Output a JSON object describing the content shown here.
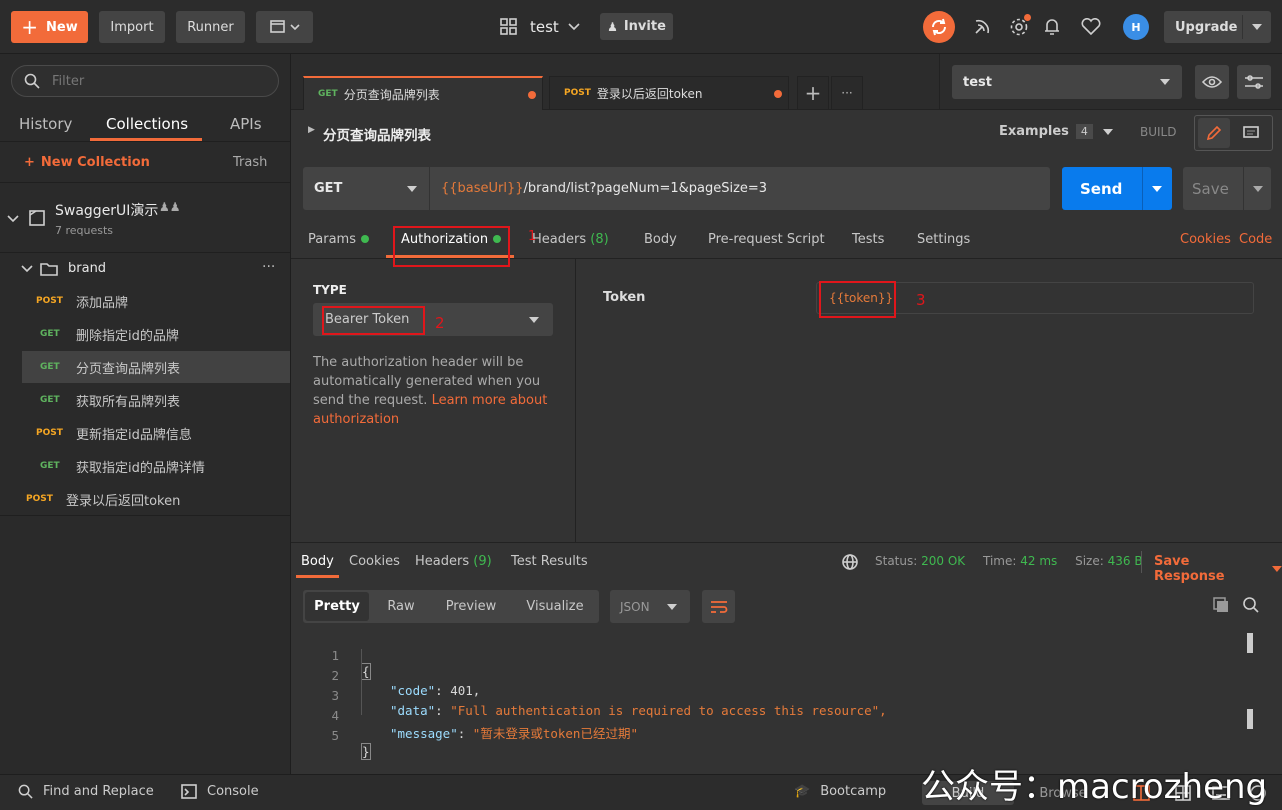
{
  "topbar": {
    "new_label": "New",
    "import_label": "Import",
    "runner_label": "Runner",
    "workspace_name": "test",
    "invite_label": "Invite",
    "upgrade_label": "Upgrade"
  },
  "sidebar": {
    "filter_placeholder": "Filter",
    "tabs": [
      "History",
      "Collections",
      "APIs"
    ],
    "active_tab": "Collections",
    "new_collection_label": "New Collection",
    "trash_label": "Trash",
    "collection": {
      "name": "SwaggerUI演示",
      "count": "7 requests"
    },
    "folder": {
      "name": "brand"
    },
    "items": [
      {
        "method": "POST",
        "label": "添加品牌"
      },
      {
        "method": "GET",
        "label": "删除指定id的品牌"
      },
      {
        "method": "GET",
        "label": "分页查询品牌列表"
      },
      {
        "method": "GET",
        "label": "获取所有品牌列表"
      },
      {
        "method": "POST",
        "label": "更新指定id品牌信息"
      },
      {
        "method": "GET",
        "label": "获取指定id的品牌详情"
      }
    ],
    "root_item": {
      "method": "POST",
      "label": "登录以后返回token"
    }
  },
  "request_tabs": [
    {
      "method": "GET",
      "label": "分页查询品牌列表"
    },
    {
      "method": "POST",
      "label": "登录以后返回token"
    }
  ],
  "environment": {
    "selected": "test"
  },
  "request": {
    "title": "分页查询品牌列表",
    "examples_label": "Examples",
    "examples_count": "4",
    "build_label": "BUILD",
    "method": "GET",
    "url_var": "{{baseUrl}}",
    "url_path": "/brand/list?pageNum=1&pageSize=3",
    "send_label": "Send",
    "save_label": "Save"
  },
  "subtabs": {
    "params": "Params",
    "authorization": "Authorization",
    "headers": "Headers",
    "headers_count": "(8)",
    "body": "Body",
    "prerequest": "Pre-request Script",
    "tests": "Tests",
    "settings": "Settings",
    "cookies": "Cookies",
    "code": "Code"
  },
  "auth": {
    "type_label": "TYPE",
    "type_value": "Bearer Token",
    "description": "The authorization header will be automatically generated when you send the request.",
    "learn_more": "Learn more about authorization",
    "token_label": "Token",
    "token_value": "{{token}}"
  },
  "annotations": [
    "1",
    "2",
    "3"
  ],
  "response": {
    "tabs": {
      "body": "Body",
      "cookies": "Cookies",
      "headers": "Headers",
      "headers_count": "(9)",
      "test_results": "Test Results"
    },
    "status_label": "Status:",
    "status_value": "200 OK",
    "time_label": "Time:",
    "time_value": "42 ms",
    "size_label": "Size:",
    "size_value": "436 B",
    "save_response": "Save Response",
    "view_modes": [
      "Pretty",
      "Raw",
      "Preview",
      "Visualize"
    ],
    "format": "JSON",
    "lines": [
      {
        "n": "1",
        "text": "{"
      },
      {
        "n": "2",
        "key": "\"code\"",
        "value": "401,",
        "type": "num"
      },
      {
        "n": "3",
        "key": "\"data\"",
        "value": "\"Full authentication is required to access this resource\",",
        "type": "str"
      },
      {
        "n": "4",
        "key": "\"message\"",
        "value": "\"暂未登录或token已经过期\"",
        "type": "str"
      },
      {
        "n": "5",
        "text": "}"
      }
    ]
  },
  "footer": {
    "find_replace": "Find and Replace",
    "console": "Console",
    "bootcamp": "Bootcamp",
    "build": "Build",
    "browse": "Browse",
    "watermark": "公众号：macrozheng"
  },
  "colors": {
    "accent": "#f26b3a",
    "send": "#097bed",
    "annotation": "#e0161b"
  }
}
